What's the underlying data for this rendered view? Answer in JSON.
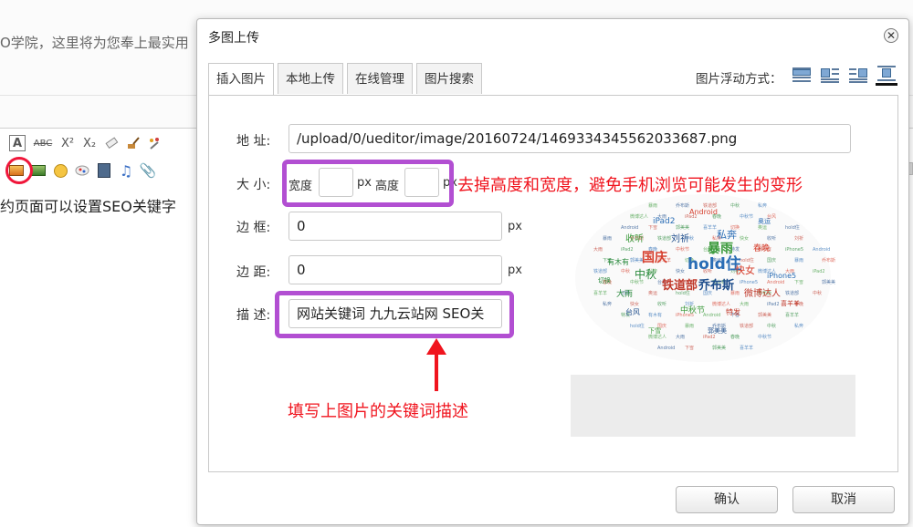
{
  "background": {
    "intro_text": "O学院，这里将为您奉上最实用",
    "content_line": "约页面可以设置SEO关键字",
    "toolbar_row1": [
      "A",
      "ABC",
      "X²",
      "X₂"
    ],
    "toolbar_row2_icons": [
      "insert-image-icon",
      "multi-image-icon",
      "emoticon-icon",
      "scrawl-icon",
      "video-icon",
      "music-icon",
      "attachment-icon"
    ]
  },
  "dialog": {
    "title": "多图上传",
    "close_symbol": "✕",
    "tabs": [
      {
        "label": "插入图片",
        "active": true
      },
      {
        "label": "本地上传",
        "active": false
      },
      {
        "label": "在线管理",
        "active": false
      },
      {
        "label": "图片搜索",
        "active": false
      }
    ],
    "float_label": "图片浮动方式：",
    "float_options": [
      "none",
      "left",
      "right",
      "center"
    ],
    "float_selected": "center",
    "form": {
      "url_label": "地 址:",
      "url_value": "/upload/0/ueditor/image/20160724/1469334345562033687.png",
      "size_label": "大 小:",
      "width_label": "宽度",
      "width_value": "",
      "height_label": "高度",
      "height_value": "",
      "unit": "px",
      "border_label": "边 框:",
      "border_value": "0",
      "margin_label": "边 距:",
      "margin_value": "0",
      "desc_label": "描 述:",
      "desc_value": "网站关键词 九九云站网 SEO关"
    },
    "annotations": {
      "size_note": "去掉高度和宽度，避免手机浏览可能发生的变形",
      "desc_note": "填写上图片的关键词描述"
    },
    "preview_words": [
      "hold住",
      "国庆",
      "暴雨",
      "乔布斯",
      "铁道部",
      "中秋",
      "私奔",
      "快女",
      "收听",
      "刘祈",
      "微博达人",
      "大雨",
      "iPad2",
      "春晚",
      "中秋节",
      "台风",
      "特发",
      "有木有",
      "iPhone5",
      "Android",
      "下雪",
      "郭美美",
      "喜羊羊",
      "切换",
      "奥运"
    ],
    "ok_label": "确认",
    "cancel_label": "取消"
  },
  "colors": {
    "highlight": "#b24fd2",
    "annotation": "#f0141e",
    "ring": "#f0163a"
  }
}
